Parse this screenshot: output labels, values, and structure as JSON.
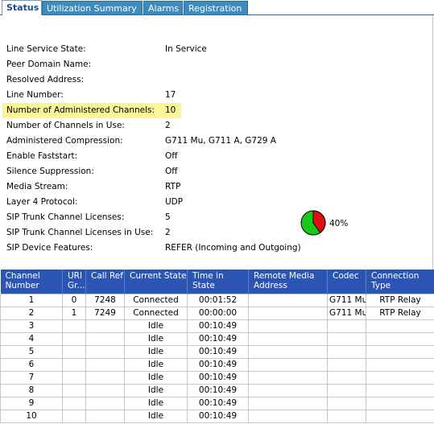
{
  "tabs": [
    {
      "label": "Status",
      "active": true
    },
    {
      "label": "Utilization Summary",
      "active": false
    },
    {
      "label": "Alarms",
      "active": false
    },
    {
      "label": "Registration",
      "active": false
    }
  ],
  "info": [
    {
      "label": "Line Service State:",
      "value": "In Service"
    },
    {
      "label": "Peer Domain Name:",
      "value": ""
    },
    {
      "label": "Resolved Address:",
      "value": ""
    },
    {
      "label": "Line Number:",
      "value": "17"
    },
    {
      "label": "Number of Administered Channels:",
      "value": "10"
    },
    {
      "label": "Number of Channels in Use:",
      "value": "2"
    },
    {
      "label": "Administered Compression:",
      "value": "G711 Mu, G711 A, G729 A"
    },
    {
      "label": "Enable Faststart:",
      "value": "Off"
    },
    {
      "label": "Silence Suppression:",
      "value": "Off"
    },
    {
      "label": "Media Stream:",
      "value": "RTP"
    },
    {
      "label": "Layer 4 Protocol:",
      "value": "UDP"
    },
    {
      "label": "SIP Trunk Channel Licenses:",
      "value": "5"
    },
    {
      "label": "SIP Trunk Channel Licenses in Use:",
      "value": "2"
    },
    {
      "label": "SIP Device Features:",
      "value": "REFER (Incoming and Outgoing)"
    }
  ],
  "highlight_color": "#fcf69a",
  "usage": {
    "percent_label": "40%",
    "fraction": 0.4,
    "used_color": "#e01010",
    "free_color": "#19c819"
  },
  "table": {
    "headers": [
      "Channel Number",
      "URI Gr...",
      "Call Ref",
      "Current State",
      "Time in State",
      "Remote Media Address",
      "Codec",
      "Connection Type"
    ],
    "rows": [
      [
        "1",
        "0",
        "7248",
        "Connected",
        "00:01:52",
        "",
        "G711 Mu",
        "RTP Relay"
      ],
      [
        "2",
        "1",
        "7249",
        "Connected",
        "00:00:00",
        "",
        "G711 Mu",
        "RTP Relay"
      ],
      [
        "3",
        "",
        "",
        "Idle",
        "00:10:49",
        "",
        "",
        ""
      ],
      [
        "4",
        "",
        "",
        "Idle",
        "00:10:49",
        "",
        "",
        ""
      ],
      [
        "5",
        "",
        "",
        "Idle",
        "00:10:49",
        "",
        "",
        ""
      ],
      [
        "6",
        "",
        "",
        "Idle",
        "00:10:49",
        "",
        "",
        ""
      ],
      [
        "7",
        "",
        "",
        "Idle",
        "00:10:49",
        "",
        "",
        ""
      ],
      [
        "8",
        "",
        "",
        "Idle",
        "00:10:49",
        "",
        "",
        ""
      ],
      [
        "9",
        "",
        "",
        "Idle",
        "00:10:49",
        "",
        "",
        ""
      ],
      [
        "10",
        "",
        "",
        "Idle",
        "00:10:49",
        "",
        "",
        ""
      ]
    ]
  }
}
